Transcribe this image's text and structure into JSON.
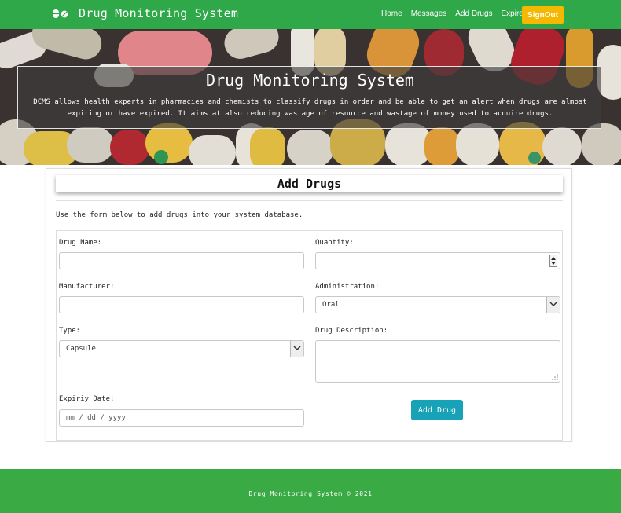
{
  "navbar": {
    "brand_icon": "pills-icon",
    "brand": "Drug Monitoring System",
    "links": [
      "Home",
      "Messages",
      "Add Drugs",
      "Expired"
    ],
    "signout": "SignOut"
  },
  "hero": {
    "title": "Drug Monitoring System",
    "description": "DCMS allows health experts in pharmacies and chemists to classify drugs in order and be able to get an alert when drugs are almost expiring or have expired. It aims at also reducing wastage of resource and wastage of money used to acquire drugs."
  },
  "card": {
    "title": "Add Drugs",
    "intro": "Use the form below to add drugs into your system database."
  },
  "form": {
    "drug_name_label": "Drug Name:",
    "drug_name_value": "",
    "quantity_label": "Quantity:",
    "quantity_value": "",
    "manufacturer_label": "Manufacturer:",
    "manufacturer_value": "",
    "administration_label": "Administration:",
    "administration_selected": "Oral",
    "type_label": "Type:",
    "type_selected": "Capsule",
    "description_label": "Drug Description:",
    "description_value": "",
    "expiry_label": "Expiriy Date:",
    "expiry_placeholder": "mm / dd / yyyy",
    "submit": "Add Drug"
  },
  "footer": {
    "text": "Drug Monitoring System © 2021"
  },
  "colors": {
    "navbar": "#2fa84a",
    "signout": "#f5b800",
    "submit": "#17a2b8",
    "footer": "#3aaa45"
  }
}
